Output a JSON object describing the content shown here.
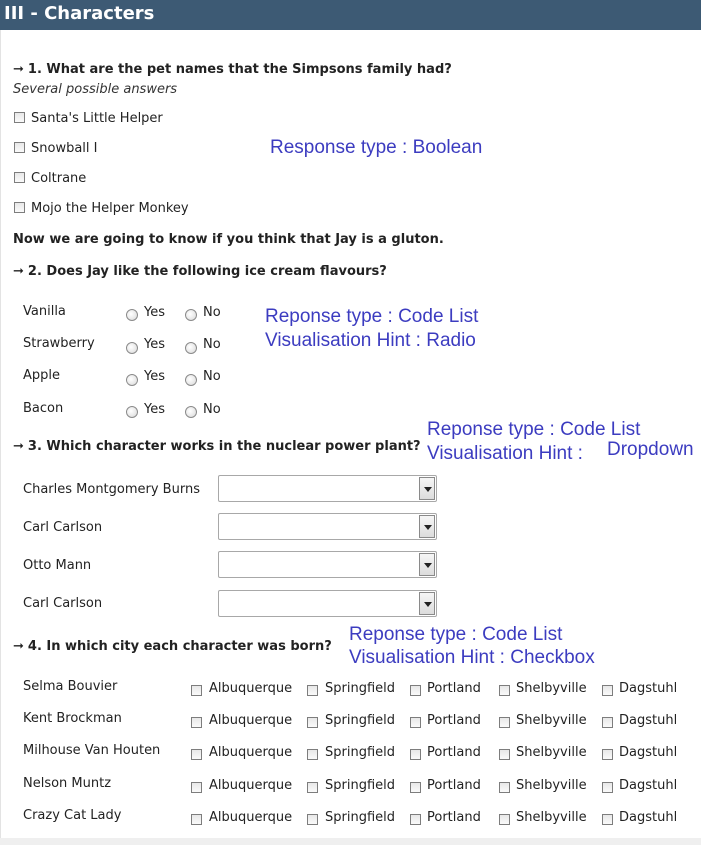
{
  "header": {
    "title": "III - Characters"
  },
  "q1": {
    "title": "1. What are the pet names that the Simpsons family had?",
    "subtitle": "Several possible answers",
    "options": [
      "Santa's Little Helper",
      "Snowball I",
      "Coltrane",
      "Mojo the Helper Monkey"
    ],
    "annotation": "Response type : Boolean"
  },
  "intro_text": "Now we are going to know if you think that Jay is a gluton.",
  "q2": {
    "title": "2. Does Jay like the following ice cream flavours?",
    "rows": [
      "Vanilla",
      "Strawberry",
      "Apple",
      "Bacon"
    ],
    "yes_label": "Yes",
    "no_label": "No",
    "annotation_line1": "Reponse type : Code List",
    "annotation_line2": "Visualisation Hint : Radio"
  },
  "q3": {
    "title": "3. Which character works in the nuclear power plant?",
    "rows": [
      "Charles Montgomery Burns",
      "Carl Carlson",
      "Otto Mann",
      "Carl Carlson"
    ],
    "selected_values": [
      "",
      "",
      "",
      ""
    ],
    "annotation_line1": "Reponse type : Code List",
    "annotation_line2a": "Visualisation Hint :",
    "annotation_line2b": "Dropdown"
  },
  "q4": {
    "title": "4. In which city each character was born?",
    "rows": [
      "Selma Bouvier",
      "Kent Brockman",
      "Milhouse Van Houten",
      "Nelson Muntz",
      "Crazy Cat Lady"
    ],
    "cities": [
      "Albuquerque",
      "Springfield",
      "Portland",
      "Shelbyville",
      "Dagstuhl"
    ],
    "annotation_line1": "Reponse type : Code List",
    "annotation_line2": "Visualisation Hint : Checkbox"
  },
  "colors": {
    "header_bg": "#3d5a74",
    "annotation": "#3c3cc0"
  },
  "icons": {
    "arrow": "right-arrow-icon",
    "dropdown": "chevron-down-icon"
  }
}
